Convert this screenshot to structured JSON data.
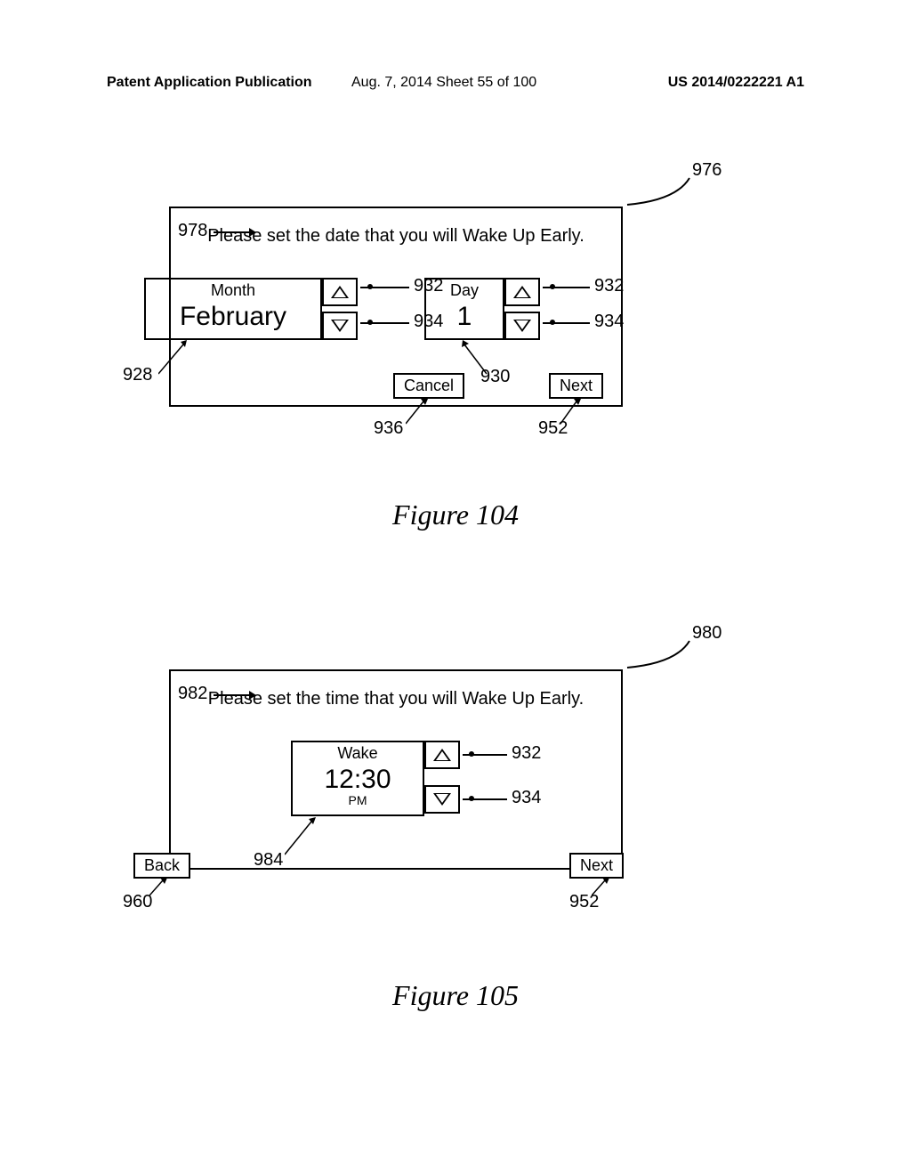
{
  "header": {
    "left": "Patent Application Publication",
    "mid": "Aug. 7, 2014   Sheet 55 of 100",
    "right": "US 2014/0222221 A1"
  },
  "fig104": {
    "prompt": "Please set the date that you will Wake Up Early.",
    "month_label": "Month",
    "month_value": "February",
    "day_label": "Day",
    "day_value": "1",
    "cancel": "Cancel",
    "next": "Next",
    "caption": "Figure 104",
    "refs": {
      "r976": "976",
      "r978": "978",
      "r932a": "932",
      "r934a": "934",
      "r932b": "932",
      "r934b": "934",
      "r928": "928",
      "r930": "930",
      "r936": "936",
      "r952": "952"
    }
  },
  "fig105": {
    "prompt": "Please set the time that you will Wake Up Early.",
    "wake_label": "Wake",
    "wake_value": "12:30",
    "wake_sub": "PM",
    "back": "Back",
    "next": "Next",
    "caption": "Figure 105",
    "refs": {
      "r980": "980",
      "r982": "982",
      "r932": "932",
      "r934": "934",
      "r984": "984",
      "r960": "960",
      "r952": "952"
    }
  }
}
